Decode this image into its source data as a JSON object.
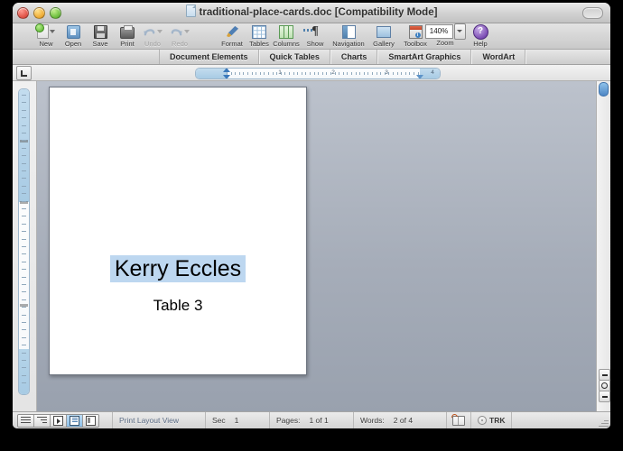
{
  "window": {
    "title": "traditional-place-cards.doc [Compatibility Mode]",
    "doc_icon": "document-icon",
    "close_label": "close",
    "minimize_label": "minimize",
    "zoom_label": "zoom",
    "toolbar_toggle_label": "toggle-toolbar"
  },
  "toolbar": {
    "items": [
      {
        "label": "New",
        "icon": "new-document-icon",
        "enabled": true,
        "has_menu": true
      },
      {
        "label": "Open",
        "icon": "open-folder-icon",
        "enabled": true,
        "has_menu": false
      },
      {
        "label": "Save",
        "icon": "save-disk-icon",
        "enabled": true,
        "has_menu": false
      },
      {
        "label": "Print",
        "icon": "printer-icon",
        "enabled": true,
        "has_menu": false
      },
      {
        "label": "Undo",
        "icon": "undo-arrow-icon",
        "enabled": false,
        "has_menu": true
      },
      {
        "label": "Redo",
        "icon": "redo-arrow-icon",
        "enabled": false,
        "has_menu": true
      },
      {
        "label": "Format",
        "icon": "format-brush-icon",
        "enabled": true,
        "has_menu": false
      },
      {
        "label": "Tables",
        "icon": "tables-grid-icon",
        "enabled": true,
        "has_menu": false
      },
      {
        "label": "Columns",
        "icon": "columns-icon",
        "enabled": true,
        "has_menu": false
      },
      {
        "label": "Show",
        "icon": "pilcrow-icon",
        "enabled": true,
        "has_menu": false
      },
      {
        "label": "Navigation",
        "icon": "navigation-pane-icon",
        "enabled": true,
        "has_menu": false
      },
      {
        "label": "Gallery",
        "icon": "gallery-icon",
        "enabled": true,
        "has_menu": false
      },
      {
        "label": "Toolbox",
        "icon": "toolbox-icon",
        "enabled": true,
        "has_menu": false
      }
    ],
    "zoom": {
      "label": "Zoom",
      "value": "140%",
      "dropdown_icon": "chevron-down-icon"
    },
    "help": {
      "label": "Help",
      "icon": "help-question-icon",
      "glyph": "?"
    }
  },
  "elements_gallery": {
    "tabs": [
      {
        "label": "Document Elements",
        "active": false
      },
      {
        "label": "Quick Tables",
        "active": false
      },
      {
        "label": "Charts",
        "active": false
      },
      {
        "label": "SmartArt Graphics",
        "active": false
      },
      {
        "label": "WordArt",
        "active": false
      }
    ]
  },
  "ruler": {
    "tab_selector_icon": "tab-stop-selector-icon",
    "numbers": [
      "1",
      "2",
      "3",
      "4"
    ],
    "first_line_indent_icon": "first-line-indent-marker",
    "left_indent_icon": "left-indent-marker",
    "right_indent_icon": "right-indent-marker"
  },
  "document": {
    "lines": [
      {
        "text": "Kerry Eccles",
        "selected": true,
        "size": "large"
      },
      {
        "text": "Table 3",
        "selected": false,
        "size": "small"
      }
    ],
    "selection_color": "#bdd7f0",
    "page_background": "#ffffff",
    "canvas_background": "#a6adb9"
  },
  "scrollbar": {
    "thumb_label": "vertical-scroll-thumb",
    "browse_previous_label": "previous-page",
    "browse_object_label": "select-browse-object",
    "browse_next_label": "next-page"
  },
  "statusbar": {
    "view_buttons": [
      {
        "name": "draft-view",
        "active": false
      },
      {
        "name": "outline-view",
        "active": false
      },
      {
        "name": "publishing-view",
        "active": false
      },
      {
        "name": "print-layout-view",
        "active": true
      },
      {
        "name": "notebook-view",
        "active": false
      }
    ],
    "view_name": "Print Layout View",
    "section": {
      "key": "Sec",
      "value": "1"
    },
    "pages": {
      "key": "Pages:",
      "value": "1 of 1"
    },
    "words": {
      "key": "Words:",
      "value": "2 of 4"
    },
    "spelling_icon": "spelling-book-icon",
    "track_changes": {
      "icon": "track-changes-icon",
      "label": "TRK"
    },
    "resize_grip": "resize-grip"
  }
}
